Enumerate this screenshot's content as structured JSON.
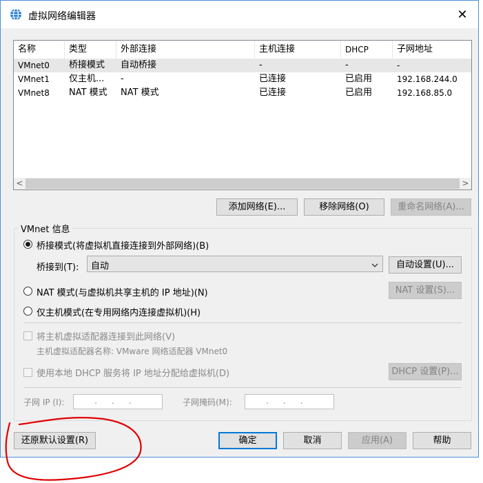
{
  "window": {
    "title": "虚拟网络编辑器",
    "close_glyph": "✕"
  },
  "network_list": {
    "columns": [
      "名称",
      "类型",
      "外部连接",
      "主机连接",
      "DHCP",
      "子网地址"
    ],
    "rows": [
      {
        "name": "VMnet0",
        "type": "桥接模式",
        "external": "自动桥接",
        "host": "-",
        "dhcp": "-",
        "subnet": "-"
      },
      {
        "name": "VMnet1",
        "type": "仅主机...",
        "external": "-",
        "host": "已连接",
        "dhcp": "已启用",
        "subnet": "192.168.244.0"
      },
      {
        "name": "VMnet8",
        "type": "NAT 模式",
        "external": "NAT 模式",
        "host": "已连接",
        "dhcp": "已启用",
        "subnet": "192.168.85.0"
      }
    ],
    "scroll_left": "<",
    "scroll_right": ">"
  },
  "list_buttons": {
    "add": "添加网络(E)...",
    "remove": "移除网络(O)",
    "rename": "重命名网络(A)..."
  },
  "vmnet_info": {
    "group_label": "VMnet 信息",
    "bridge_mode": "桥接模式(将虚拟机直接连接到外部网络)(B)",
    "bridge_to_label": "桥接到(T):",
    "bridge_to_value": "自动",
    "auto_settings": "自动设置(U)...",
    "nat_mode": "NAT 模式(与虚拟机共享主机的 IP 地址)(N)",
    "nat_settings": "NAT 设置(S)...",
    "host_only_mode": "仅主机模式(在专用网络内连接虚拟机)(H)",
    "connect_adapter": "将主机虚拟适配器连接到此网络(V)",
    "adapter_name": "主机虚拟适配器名称: VMware 网络适配器 VMnet0",
    "use_dhcp": "使用本地 DHCP 服务将 IP 地址分配给虚拟机(D)",
    "dhcp_settings": "DHCP 设置(P)...",
    "subnet_ip_label": "子网 IP (I):",
    "subnet_ip_value": ".     .     .",
    "subnet_mask_label": "子网掩码(M):",
    "subnet_mask_value": ".     .     ."
  },
  "footer": {
    "restore": "还原默认设置(R)",
    "ok": "确定",
    "cancel": "取消",
    "apply": "应用(A)",
    "help": "帮助"
  },
  "colors": {
    "accent": "#0078d7",
    "annotation": "#e00000"
  }
}
